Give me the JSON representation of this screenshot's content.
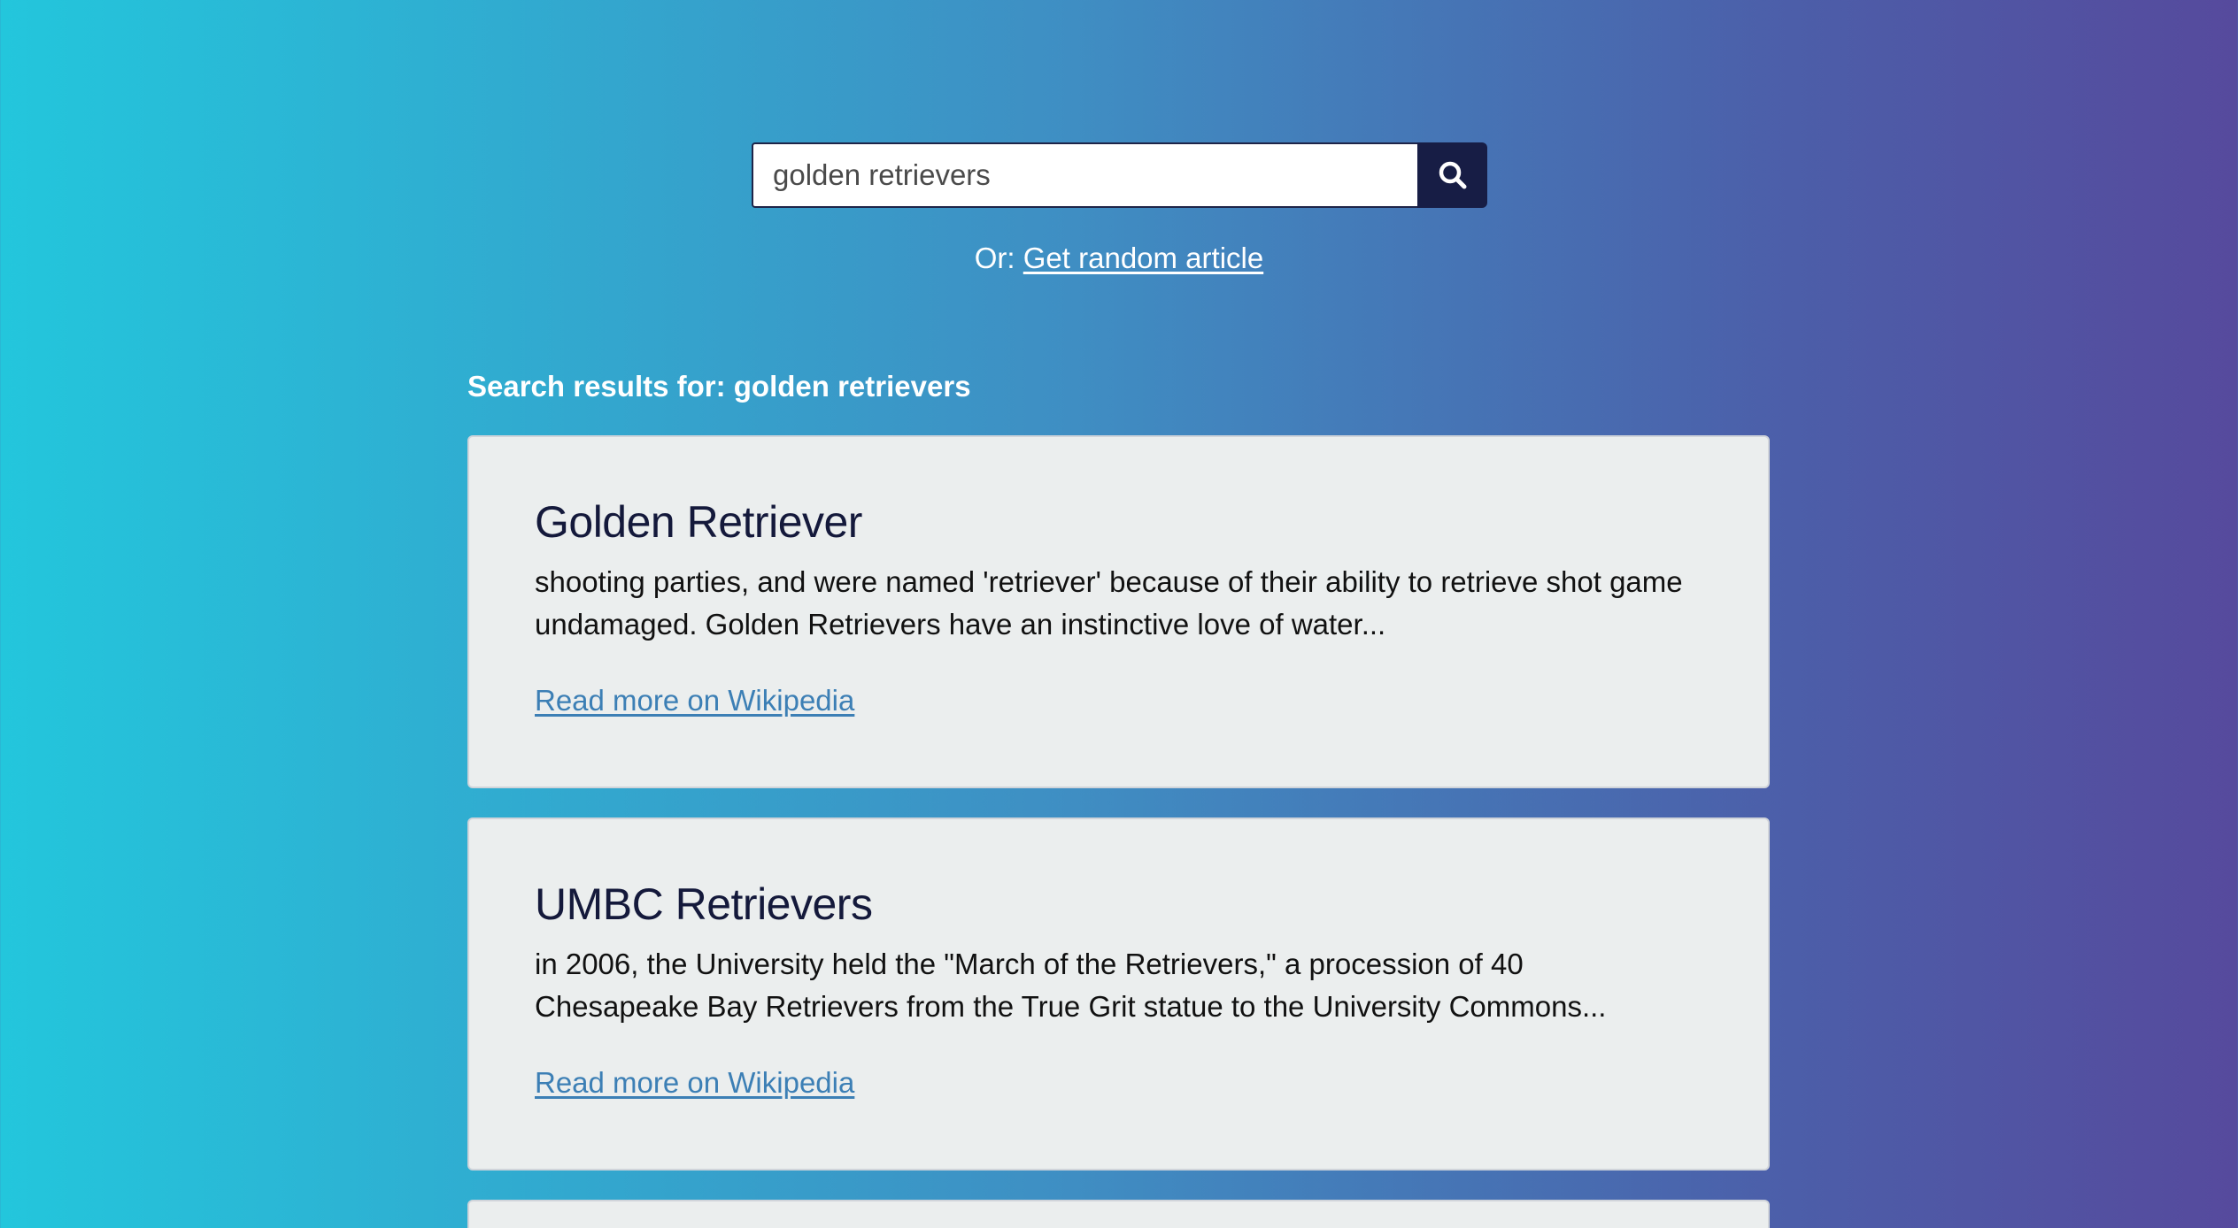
{
  "search": {
    "value": "golden retrievers",
    "button_icon": "search-icon"
  },
  "random": {
    "prefix": "Or: ",
    "link_label": "Get random article"
  },
  "results": {
    "heading": "Search results for: golden retrievers",
    "items": [
      {
        "title": "Golden Retriever",
        "snippet": "shooting parties, and were named 'retriever' because of their ability to retrieve shot game undamaged. Golden Retrievers have an instinctive love of water...",
        "link_label": "Read more on Wikipedia"
      },
      {
        "title": "UMBC Retrievers",
        "snippet": "in 2006, the University held the \"March of the Retrievers,\" a procession of 40 Chesapeake Bay Retrievers from the True Grit statue to the University Commons...",
        "link_label": "Read more on Wikipedia"
      }
    ]
  },
  "colors": {
    "gradient_start": "#23c6dc",
    "gradient_end": "#564a9d",
    "card_background": "#ebeeee",
    "title_color": "#14193b",
    "link_color": "#3c7fb5",
    "search_button": "#171d45"
  }
}
